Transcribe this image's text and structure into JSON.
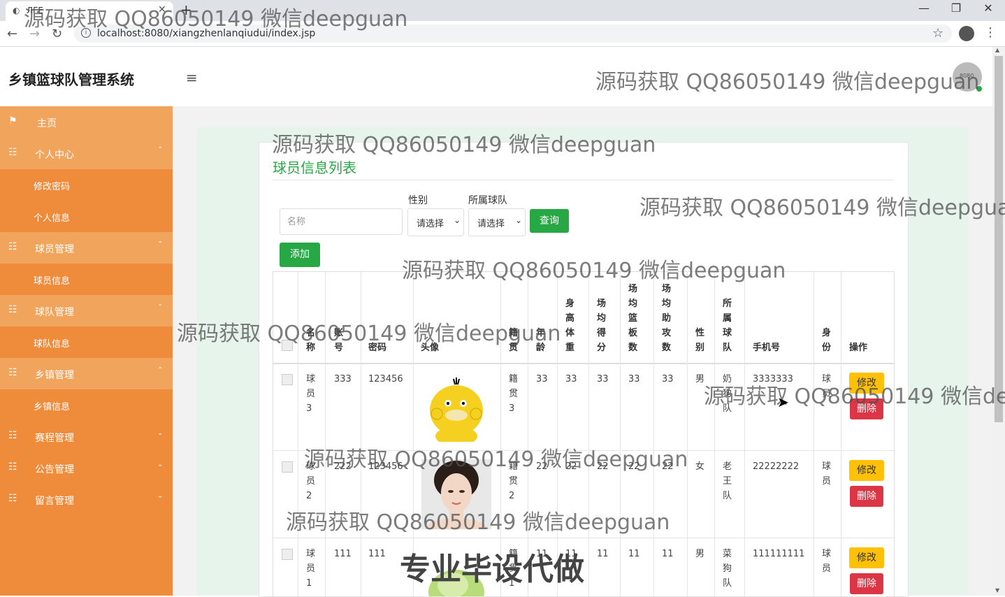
{
  "browser": {
    "tab_title": "ЛГЕ",
    "url": "localhost:8080/xiangzhenlanqiudui/index.jsp"
  },
  "app": {
    "brand": "乡镇篮球队管理系统",
    "avatar_text": "8080"
  },
  "sidebar": {
    "items": [
      {
        "label": "主页",
        "icon": "flag-icon",
        "type": "head"
      },
      {
        "label": "个人中心",
        "icon": "grid-icon",
        "type": "head",
        "caret": "up"
      },
      {
        "label": "修改密码",
        "type": "sub"
      },
      {
        "label": "个人信息",
        "type": "sub"
      },
      {
        "label": "球员管理",
        "icon": "grid-icon",
        "type": "head",
        "caret": "up"
      },
      {
        "label": "球员信息",
        "type": "sub"
      },
      {
        "label": "球队管理",
        "icon": "grid-icon",
        "type": "head",
        "caret": "up"
      },
      {
        "label": "球队信息",
        "type": "sub"
      },
      {
        "label": "乡镇管理",
        "icon": "grid-icon",
        "type": "head",
        "caret": "up"
      },
      {
        "label": "乡镇信息",
        "type": "sub"
      },
      {
        "label": "赛程管理",
        "icon": "grid-icon",
        "type": "head",
        "caret": "down"
      },
      {
        "label": "公告管理",
        "icon": "grid-icon",
        "type": "head",
        "caret": "down"
      },
      {
        "label": "留言管理",
        "icon": "grid-icon",
        "type": "head",
        "caret": "down"
      }
    ]
  },
  "page": {
    "title": "球员信息列表",
    "search_placeholder": "名称",
    "gender_label": "性别",
    "gender_value": "请选择",
    "team_label": "所属球队",
    "team_value": "请选择",
    "query_button": "查询",
    "add_button": "添加"
  },
  "table": {
    "headers": [
      "名\n称",
      "账\n号",
      "密码",
      "头像",
      "籍\n贯",
      "年\n龄",
      "身\n高\n体\n重",
      "场\n均\n得\n分",
      "场\n均\n篮\n板\n数",
      "场\n均\n助\n攻\n数",
      "性\n别",
      "所\n属\n球\n队",
      "手机号",
      "身\n份",
      "操作"
    ],
    "rows": [
      {
        "name": "球\n员\n3",
        "account": "333",
        "password": "123456",
        "avatar": "duck",
        "origin": "籍\n贯\n3",
        "age": "33",
        "height_weight": "33",
        "ppg": "33",
        "rpg": "33",
        "apg": "33",
        "gender": "男",
        "team": "奶\n狗\n队",
        "phone": "3333333",
        "role": "球\n员",
        "edit": "修改",
        "delete": "删除"
      },
      {
        "name": "球\n员\n2",
        "account": "222",
        "password": "123456",
        "avatar": "portrait",
        "origin": "籍\n贯\n2",
        "age": "22",
        "height_weight": "22",
        "ppg": "22",
        "rpg": "22",
        "apg": "22",
        "gender": "女",
        "team": "老\n王\n队",
        "phone": "22222222",
        "role": "球\n员",
        "edit": "修改",
        "delete": "删除"
      },
      {
        "name": "球\n员\n1",
        "account": "111",
        "password": "111",
        "avatar": "cabbage",
        "origin": "籍\n贯\n1",
        "age": "11",
        "height_weight": "11",
        "ppg": "11",
        "rpg": "11",
        "apg": "11",
        "gender": "男",
        "team": "菜\n狗\n队",
        "phone": "111111111",
        "role": "球\n员",
        "edit": "修改",
        "delete": "删除"
      }
    ]
  },
  "watermarks": {
    "text": "源码获取 QQ86050149 微信deepguan",
    "banner": "专业毕设代做"
  }
}
